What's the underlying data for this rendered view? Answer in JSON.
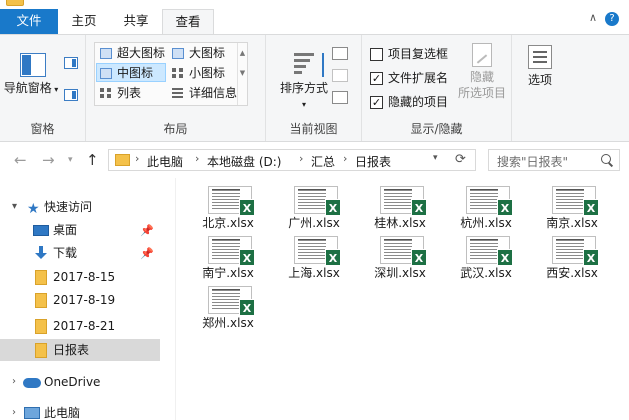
{
  "tabs": {
    "file": "文件",
    "home": "主页",
    "share": "共享",
    "view": "查看"
  },
  "ribbon": {
    "pane_group": {
      "nav_pane_line1": "导航",
      "nav_pane_line2": "窗格",
      "label": "窗格"
    },
    "layout_group": {
      "label": "布局",
      "items": [
        "超大图标",
        "大图标",
        "中图标",
        "小图标",
        "列表",
        "详细信息"
      ],
      "selected": "中图标"
    },
    "current_view_group": {
      "sort_line1": "排序方式",
      "label": "当前视图"
    },
    "show_hide_group": {
      "label": "显示/隐藏",
      "checkboxes": [
        {
          "label": "项目复选框",
          "checked": false
        },
        {
          "label": "文件扩展名",
          "checked": true
        },
        {
          "label": "隐藏的项目",
          "checked": true
        }
      ],
      "hide_selected_line1": "隐藏",
      "hide_selected_line2": "所选项目"
    },
    "options_group": {
      "label": "选项"
    }
  },
  "address": {
    "crumbs": [
      "此电脑",
      "本地磁盘 (D:)",
      "汇总",
      "日报表"
    ]
  },
  "search": {
    "placeholder": "搜索\"日报表\""
  },
  "navpane": {
    "quick_access": "快速访问",
    "items": [
      {
        "label": "桌面",
        "icon": "desktop-icon",
        "pinned": true
      },
      {
        "label": "下载",
        "icon": "download-icon",
        "pinned": true
      },
      {
        "label": "2017-8-15",
        "icon": "folder-icon",
        "pinned": false
      },
      {
        "label": "2017-8-19",
        "icon": "folder-icon",
        "pinned": false
      },
      {
        "label": "2017-8-21",
        "icon": "folder-icon",
        "pinned": false
      },
      {
        "label": "日报表",
        "icon": "folder-icon",
        "pinned": false,
        "selected": true
      }
    ],
    "onedrive": "OneDrive",
    "this_pc": "此电脑"
  },
  "files": [
    "北京.xlsx",
    "广州.xlsx",
    "桂林.xlsx",
    "杭州.xlsx",
    "南京.xlsx",
    "南宁.xlsx",
    "上海.xlsx",
    "深圳.xlsx",
    "武汉.xlsx",
    "西安.xlsx",
    "郑州.xlsx"
  ],
  "colors": {
    "accent": "#1979ca",
    "selection": "#cce8ff",
    "excel_green": "#1d7044",
    "folder": "#f4c14a"
  }
}
